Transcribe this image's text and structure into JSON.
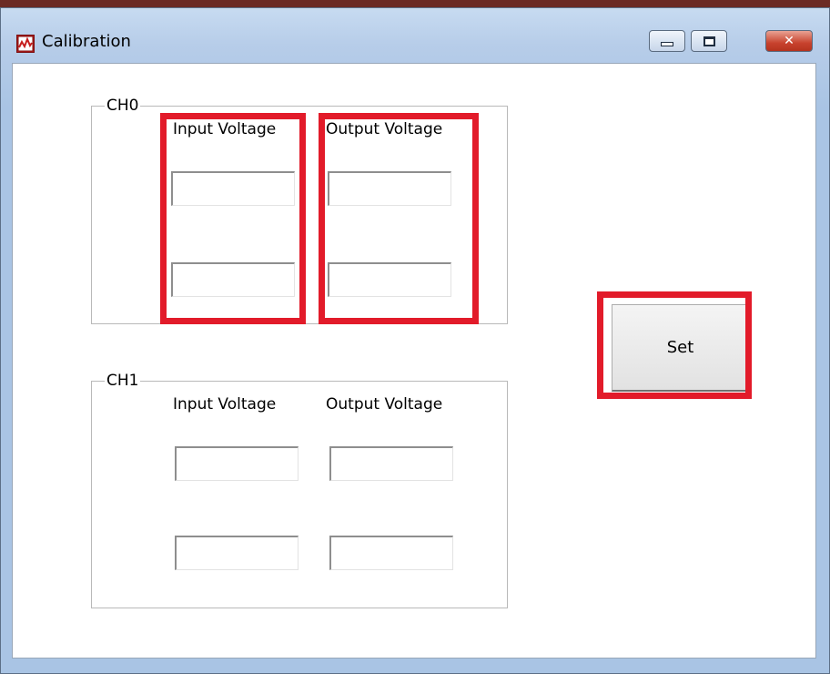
{
  "window": {
    "title": "Calibration",
    "app_icon": "waveform-icon",
    "controls": {
      "minimize": "minimize-icon",
      "maximize": "maximize-icon",
      "close": "close-icon",
      "close_glyph": "✕"
    }
  },
  "groups": [
    {
      "title": "CH0",
      "input_label": "Input Voltage",
      "output_label": "Output Voltage",
      "input_values": [
        "",
        ""
      ],
      "output_values": [
        "",
        ""
      ]
    },
    {
      "title": "CH1",
      "input_label": "Input Voltage",
      "output_label": "Output Voltage",
      "input_values": [
        "",
        ""
      ],
      "output_values": [
        "",
        ""
      ]
    }
  ],
  "set_button": {
    "label": "Set"
  },
  "colors": {
    "highlight": "#e21b2a",
    "titlebar": "#b7cde9",
    "close_button": "#c8432e"
  }
}
